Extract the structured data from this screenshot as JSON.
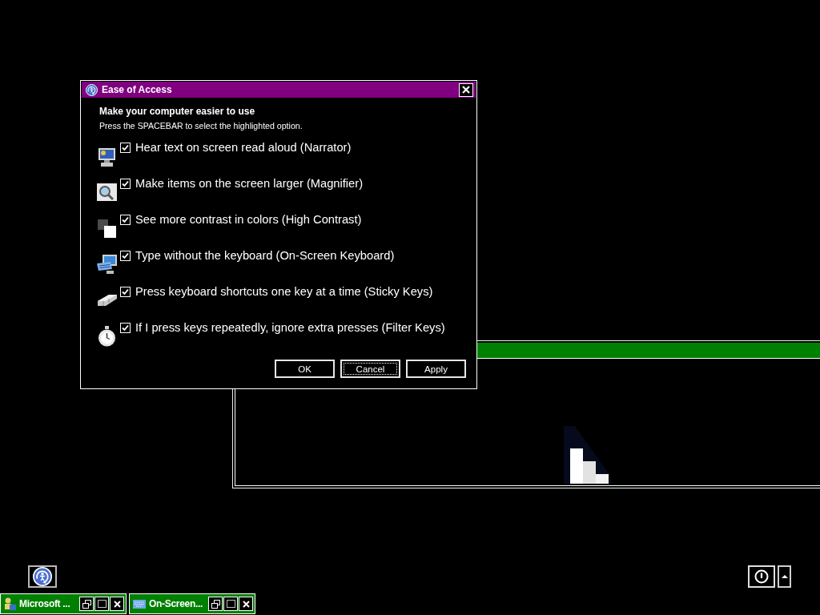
{
  "dialog": {
    "title": "Ease of Access",
    "heading": "Make your computer easier to use",
    "instruction": "Press the SPACEBAR to select the highlighted option.",
    "options": [
      {
        "label": "Hear text on screen read aloud (Narrator)",
        "checked": true
      },
      {
        "label": "Make items on the screen larger (Magnifier)",
        "checked": true
      },
      {
        "label": "See more contrast in colors (High Contrast)",
        "checked": true
      },
      {
        "label": "Type without the keyboard (On-Screen Keyboard)",
        "checked": true
      },
      {
        "label": "Press keyboard shortcuts one key at a time (Sticky Keys)",
        "checked": true
      },
      {
        "label": "If I press keys repeatedly, ignore extra presses (Filter Keys)",
        "checked": true
      }
    ],
    "buttons": [
      {
        "label": "OK",
        "focused": false
      },
      {
        "label": "Cancel",
        "focused": true
      },
      {
        "label": "Apply",
        "focused": false
      }
    ]
  },
  "taskbar": {
    "windows": [
      {
        "title": "Microsoft ..."
      },
      {
        "title": "On-Screen..."
      }
    ]
  }
}
